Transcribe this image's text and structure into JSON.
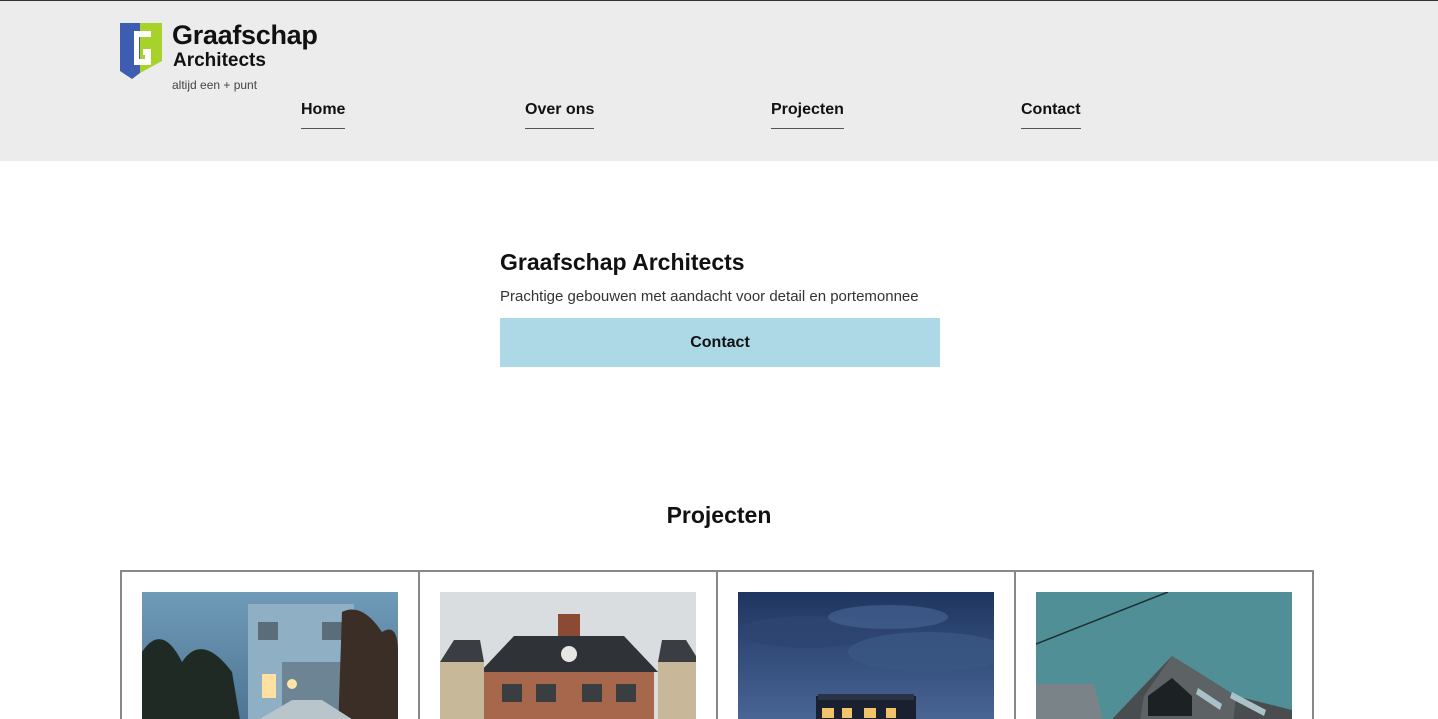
{
  "brand": {
    "name_line1": "Graafschap",
    "name_line2": "Architects",
    "tagline": "altijd een + punt",
    "colors": {
      "blue": "#3f5db0",
      "green": "#a6d22a"
    }
  },
  "nav": {
    "items": [
      {
        "label": "Home"
      },
      {
        "label": "Over ons"
      },
      {
        "label": "Projecten"
      },
      {
        "label": "Contact"
      }
    ]
  },
  "hero": {
    "title": "Graafschap Architects",
    "subtitle": "Prachtige gebouwen met aandacht voor detail en portemonnee",
    "cta_label": "Contact",
    "cta_color": "#add8e6"
  },
  "projects": {
    "title": "Projecten",
    "cards": [
      {
        "image": "modern-house-dusk-photo"
      },
      {
        "image": "brick-house-photo"
      },
      {
        "image": "house-night-sky-photo"
      },
      {
        "image": "gable-roof-house-photo"
      }
    ]
  }
}
